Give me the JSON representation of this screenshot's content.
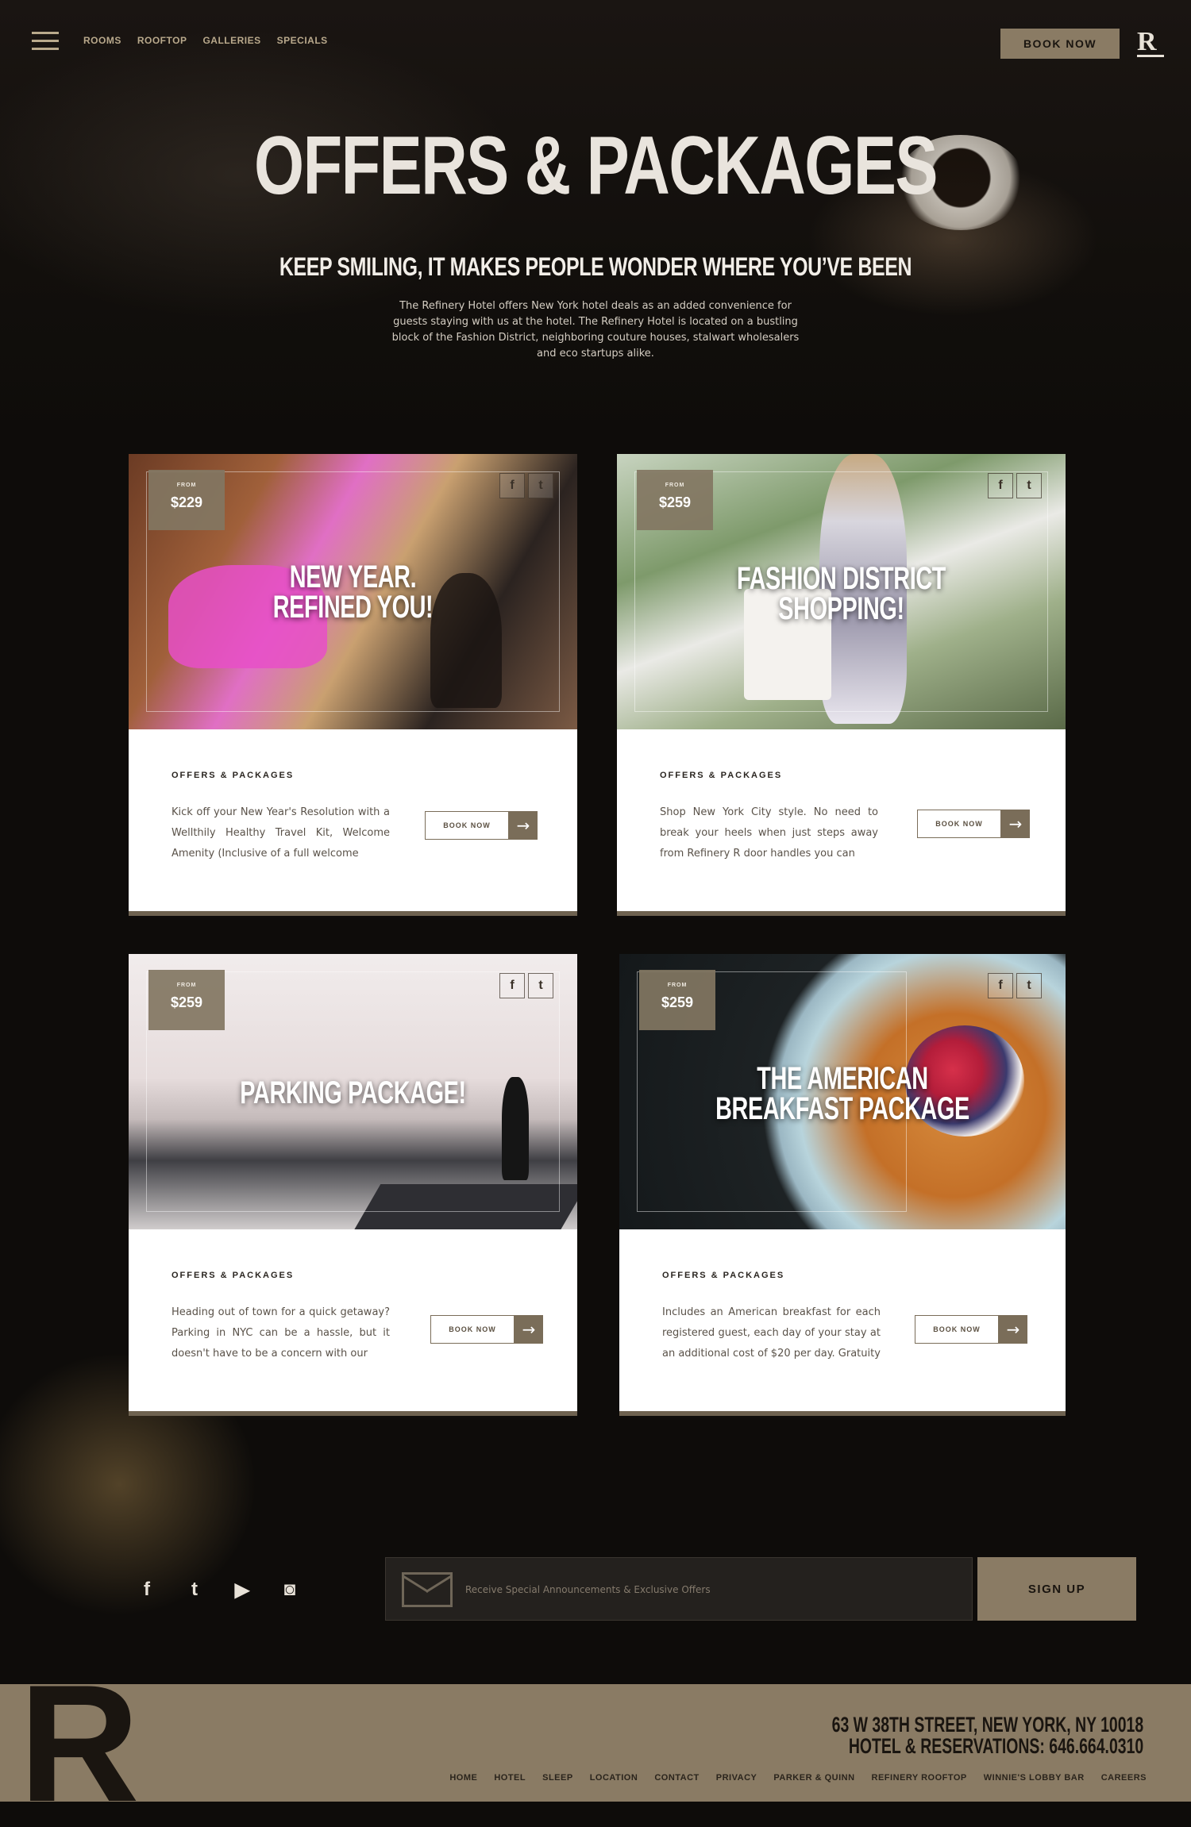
{
  "header": {
    "nav": [
      "ROOMS",
      "ROOFTOP",
      "GALLERIES",
      "SPECIALS"
    ],
    "book_now": "BOOK NOW",
    "logo": "R"
  },
  "hero": {
    "title": "OFFERS & PACKAGES",
    "subtitle": "KEEP SMILING, IT MAKES PEOPLE WONDER WHERE YOU’VE BEEN",
    "description": "The Refinery Hotel offers New York hotel deals as an added convenience for guests staying with us at the hotel. The Refinery Hotel  is located on a bustling block of the Fashion District, neighboring couture houses, stalwart wholesalers and eco startups alike."
  },
  "cards": [
    {
      "from": "FROM",
      "price": "$229",
      "title_line1": "NEW YEAR.",
      "title_line2": "REFINED YOU!",
      "label": "OFFERS & PACKAGES",
      "text": "Kick off your New Year's Resolution with a Wellthily Healthy Travel Kit, Welcome Amenity (Inclusive of a full welcome",
      "button": "BOOK NOW"
    },
    {
      "from": "FROM",
      "price": "$259",
      "title_line1": "FASHION DISTRICT",
      "title_line2": "SHOPPING!",
      "label": "OFFERS & PACKAGES",
      "text": "Shop New York City style.  No need to break your heels when just steps away from Refinery R door handles you can",
      "button": "BOOK NOW"
    },
    {
      "from": "FROM",
      "price": "$259",
      "title_line1": "PARKING PACKAGE!",
      "title_line2": "",
      "label": "OFFERS & PACKAGES",
      "text": "Heading out of town for a quick getaway? Parking in NYC can be a hassle, but it doesn't have to be a concern with our",
      "button": "BOOK NOW"
    },
    {
      "from": "FROM",
      "price": "$259",
      "title_line1": "THE AMERICAN",
      "title_line2": "BREAKFAST PACKAGE",
      "label": "OFFERS & PACKAGES",
      "text": "Includes an American breakfast for each registered guest, each day of your stay at an additional cost of $20 per day. Gratuity",
      "button": "BOOK NOW"
    }
  ],
  "newsletter": {
    "placeholder": "Receive Special Announcements & Exclusive Offers",
    "signup": "SIGN UP"
  },
  "footer": {
    "logo": "R",
    "address_line1": "63 W 38TH STREET, NEW YORK, NY 10018",
    "address_line2": "HOTEL & RESERVATIONS: 646.664.0310",
    "nav": [
      "HOME",
      "HOTEL",
      "SLEEP",
      "LOCATION",
      "CONTACT",
      "PRIVACY",
      "PARKER & QUINN",
      "REFINERY ROOFTOP",
      "WINNIE'S LOBBY BAR",
      "CAREERS"
    ]
  },
  "colors": {
    "accent": "#8a7b64",
    "background": "#0e0c0a",
    "card_button": "#7a6d59"
  },
  "icons": [
    "menu-icon",
    "facebook-icon",
    "twitter-icon",
    "youtube-icon",
    "instagram-icon",
    "envelope-icon",
    "arrow-right-icon"
  ]
}
